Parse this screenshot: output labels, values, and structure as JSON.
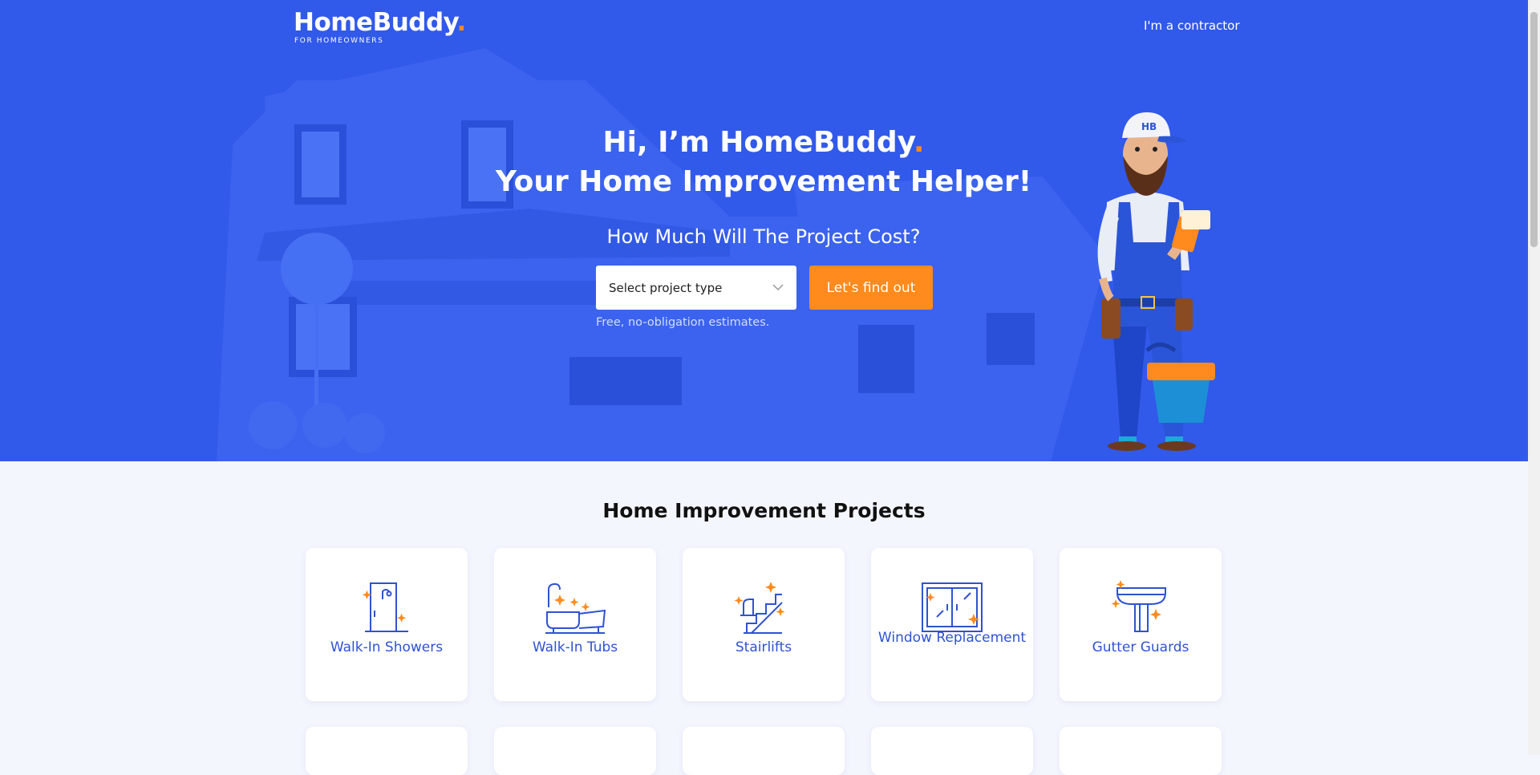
{
  "header": {
    "brand_name": "HomeBuddy",
    "brand_dot": ".",
    "brand_tagline": "FOR HOMEOWNERS",
    "contractor_link": "I'm a contractor"
  },
  "hero": {
    "headline_line1": "Hi, I’m HomeBuddy",
    "headline_dot": ".",
    "headline_line2": "Your Home Improvement Helper!",
    "subheadline": "How Much Will The Project Cost?",
    "select_placeholder": "Select project type",
    "cta_label": "Let's find out",
    "note": "Free, no-obligation estimates.",
    "mascot_cap_text": "HB"
  },
  "projects": {
    "title": "Home Improvement Projects",
    "items": [
      {
        "label": "Walk-In Showers",
        "icon": "shower-icon"
      },
      {
        "label": "Walk-In Tubs",
        "icon": "bathtub-icon"
      },
      {
        "label": "Stairlifts",
        "icon": "stairlift-icon"
      },
      {
        "label": "Window Replacement",
        "icon": "window-icon"
      },
      {
        "label": "Gutter Guards",
        "icon": "gutter-icon"
      }
    ]
  },
  "colors": {
    "hero_blue": "#3159ea",
    "accent_orange": "#ff8a1d",
    "link_blue": "#2f52d3",
    "page_bg": "#f4f6fe"
  }
}
